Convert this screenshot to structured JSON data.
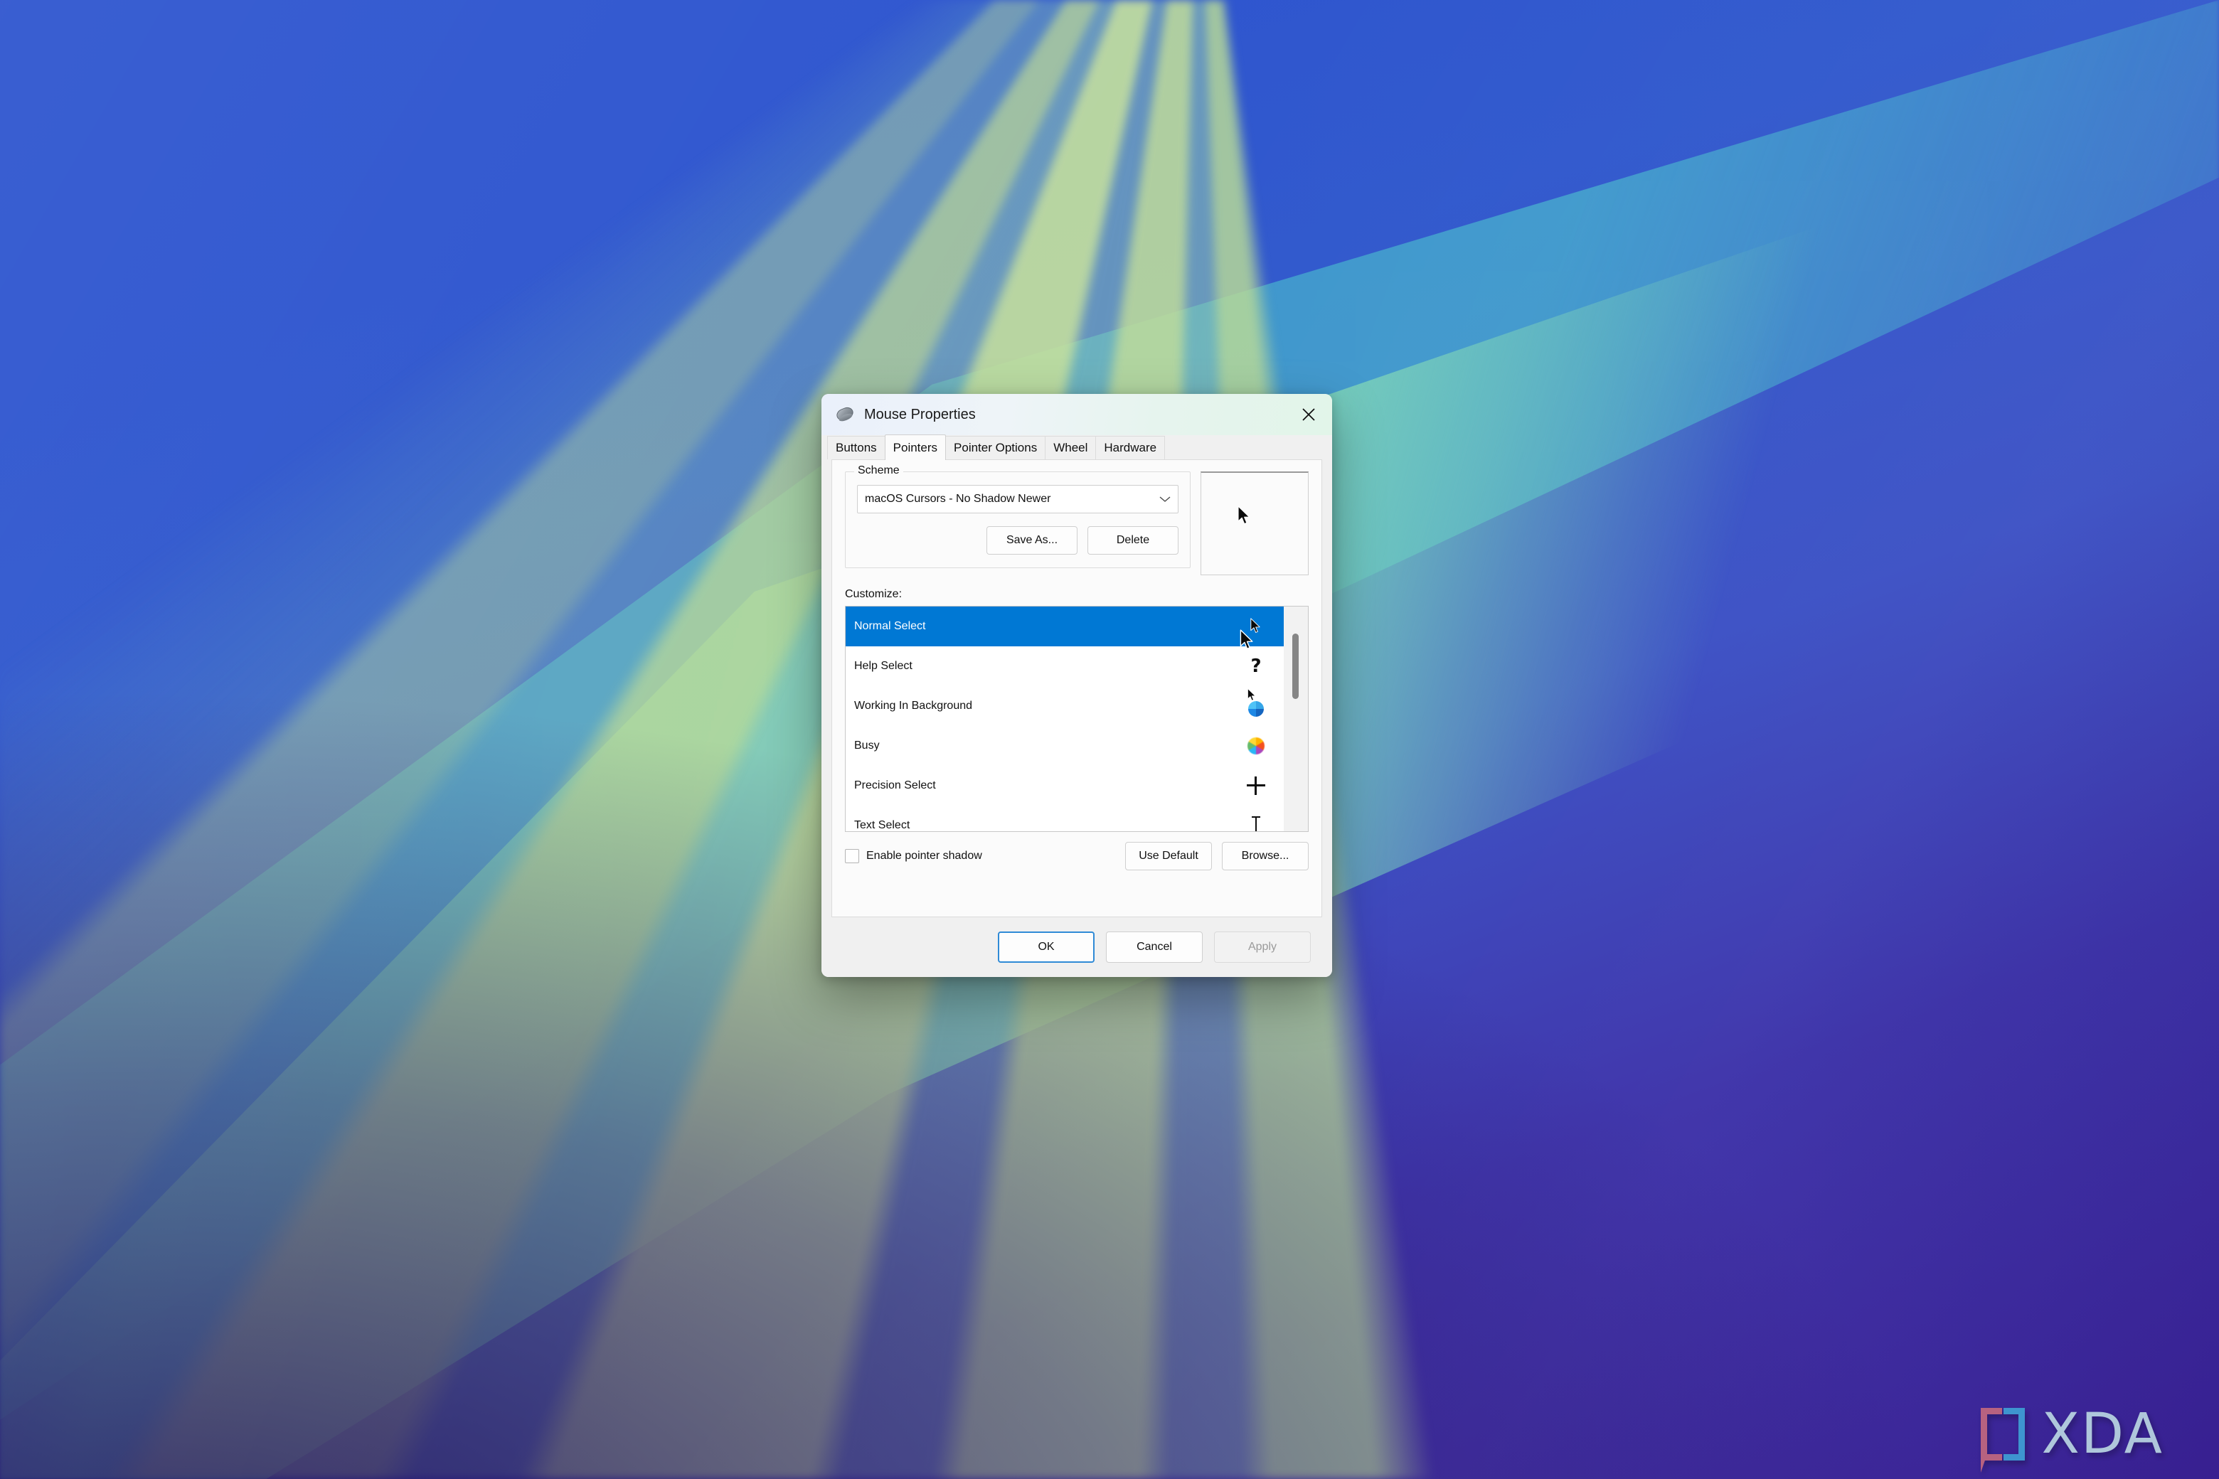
{
  "desktop": {
    "wallpaper_colors": {
      "deep_purple": "#3b2199",
      "royal_blue": "#2f56cf",
      "teal": "#6ac7bf",
      "light_green_ray": "#c4e09e",
      "cyan": "#46a8cd"
    },
    "watermark": {
      "text": "XDA",
      "bracket_left_color": "#c2687f",
      "bracket_right_color": "#3f9fd4",
      "text_color": "#b9d5e2"
    }
  },
  "window": {
    "title": "Mouse Properties",
    "icon": "mouse-icon",
    "close_label": "✕",
    "titlebar_gradient_start": "#eaf0fb",
    "titlebar_gradient_end": "#e2f5e9"
  },
  "tabs": [
    {
      "label": "Buttons",
      "active": false
    },
    {
      "label": "Pointers",
      "active": true
    },
    {
      "label": "Pointer Options",
      "active": false
    },
    {
      "label": "Wheel",
      "active": false
    },
    {
      "label": "Hardware",
      "active": false
    }
  ],
  "scheme": {
    "legend": "Scheme",
    "selected": "macOS Cursors - No Shadow Newer",
    "chevron": "⌄",
    "save_as_label": "Save As...",
    "delete_label": "Delete"
  },
  "preview": {
    "cursor": "arrow-cursor"
  },
  "customize": {
    "label": "Customize:",
    "rows": [
      {
        "label": "Normal Select",
        "glyph": "arrow-cursor",
        "selected": true
      },
      {
        "label": "Help Select",
        "glyph": "help-cursor",
        "selected": false
      },
      {
        "label": "Working In Background",
        "glyph": "working-cursor",
        "selected": false
      },
      {
        "label": "Busy",
        "glyph": "busy-cursor",
        "selected": false
      },
      {
        "label": "Precision Select",
        "glyph": "crosshair-cursor",
        "selected": false
      },
      {
        "label": "Text Select",
        "glyph": "ibeam-cursor",
        "selected": false
      }
    ],
    "selection_color": "#0078d4"
  },
  "pointer_options": {
    "shadow_checkbox_label": "Enable pointer shadow",
    "shadow_checked": false,
    "use_default_label": "Use Default",
    "browse_label": "Browse..."
  },
  "footer": {
    "ok_label": "OK",
    "cancel_label": "Cancel",
    "apply_label": "Apply",
    "apply_enabled": false,
    "focus_color": "#2f8ad6"
  }
}
